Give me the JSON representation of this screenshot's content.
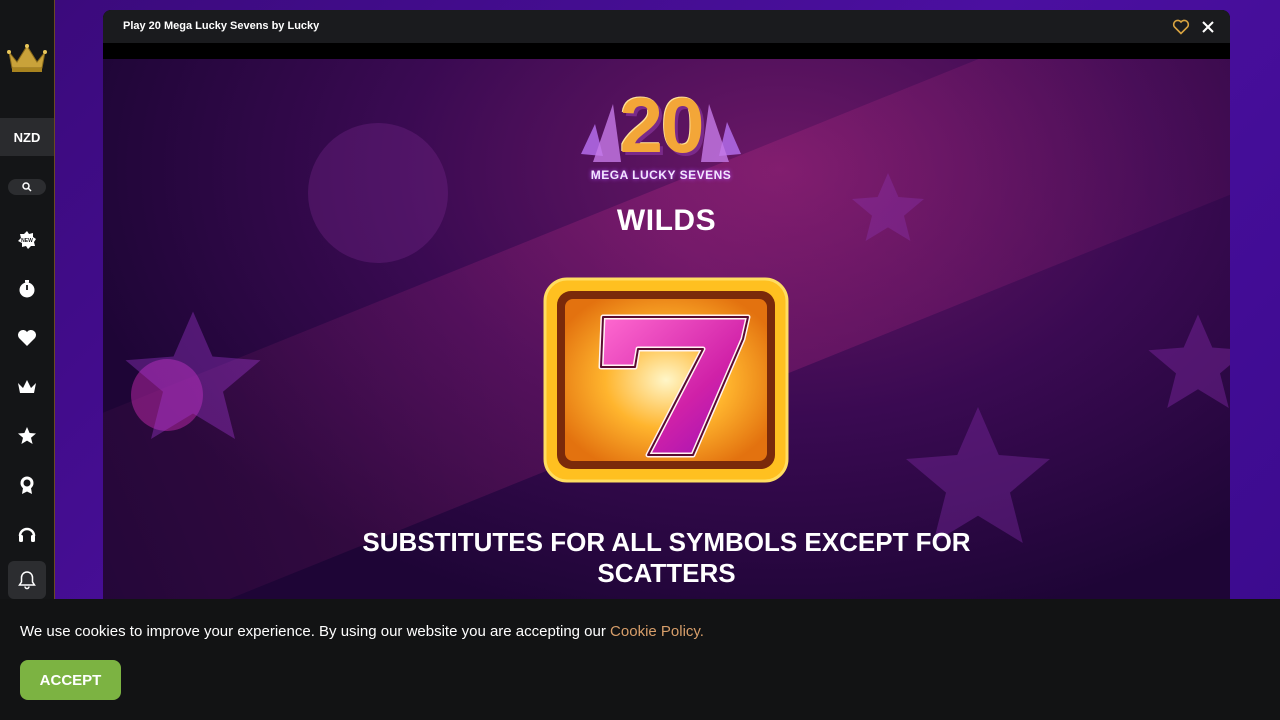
{
  "sidebar": {
    "currency": "NZD",
    "icons": [
      "crown-logo-icon",
      "search-icon",
      "new-badge-icon",
      "timer-icon",
      "heart-icon",
      "crown-icon",
      "star-icon",
      "award-icon",
      "headset-icon",
      "bell-icon"
    ]
  },
  "game_window": {
    "title": "Play 20 Mega Lucky Sevens by Lucky",
    "logo_number": "20",
    "logo_subtitle": "MEGA LUCKY SEVENS",
    "section_title": "WILDS",
    "symbol": "7",
    "description_line1": "SUBSTITUTES FOR ALL SYMBOLS EXCEPT FOR",
    "description_line2": "SCATTERS"
  },
  "cookie_banner": {
    "text": "We use cookies to improve your experience. By using our website you are accepting our ",
    "link_text": "Cookie Policy.",
    "accept_label": "ACCEPT"
  },
  "colors": {
    "accent_gold": "#d9a441",
    "cookie_link": "#d79e6a",
    "accept_green": "#7cb342"
  }
}
